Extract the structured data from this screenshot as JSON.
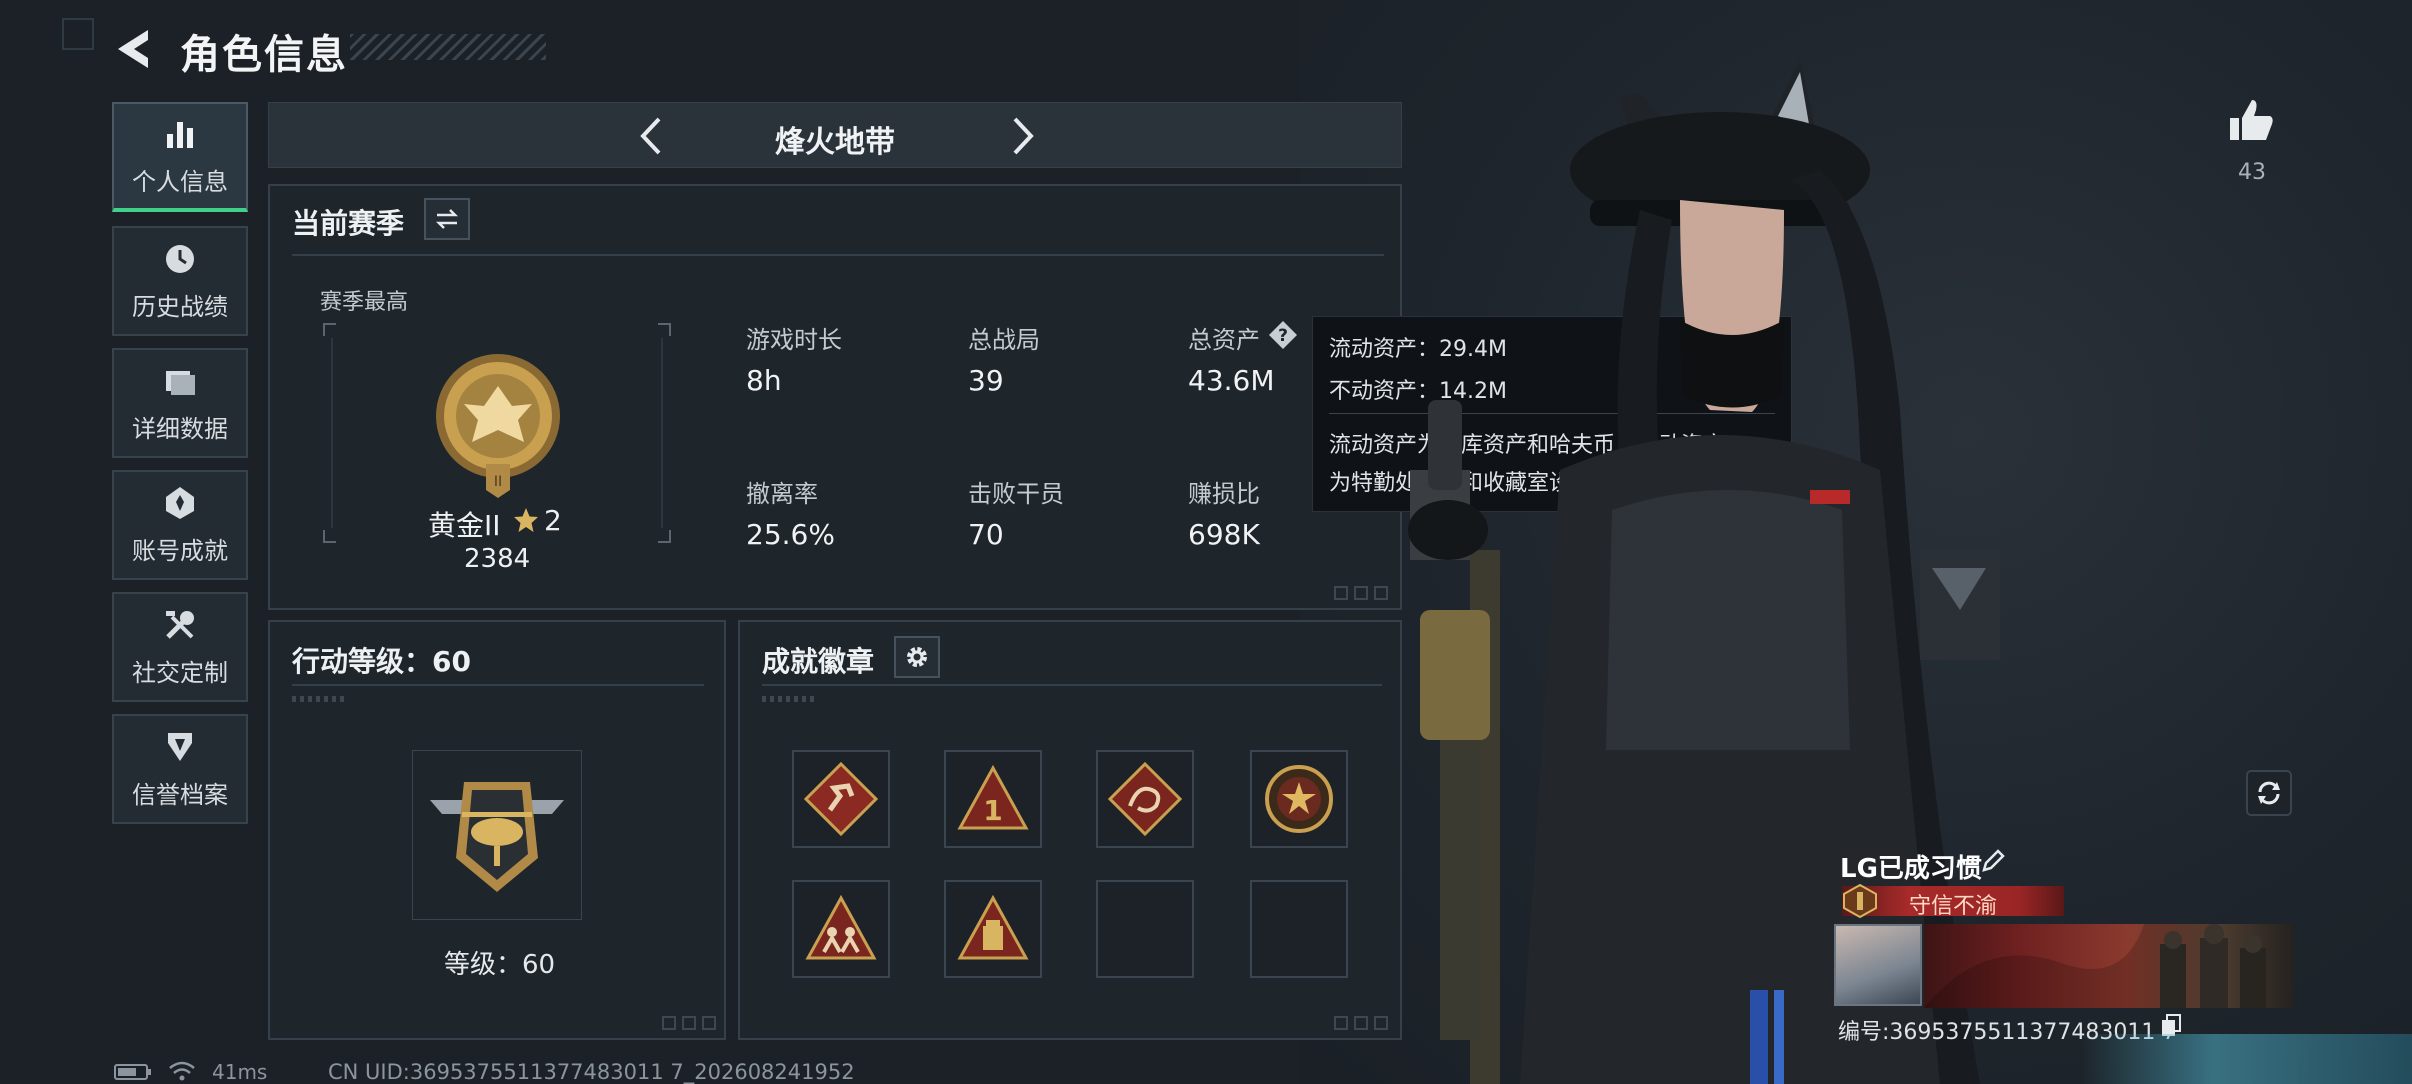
{
  "header": {
    "title": "角色信息"
  },
  "sidebar": {
    "items": [
      {
        "label": "个人信息",
        "icon": "bar-chart-icon",
        "active": true
      },
      {
        "label": "历史战绩",
        "icon": "clock-icon",
        "active": false
      },
      {
        "label": "详细数据",
        "icon": "folder-icon",
        "active": false
      },
      {
        "label": "账号成就",
        "icon": "medal-icon",
        "active": false
      },
      {
        "label": "社交定制",
        "icon": "tools-icon",
        "active": false
      },
      {
        "label": "信誉档案",
        "icon": "shield-icon",
        "active": false
      }
    ]
  },
  "mode": {
    "label": "烽火地带"
  },
  "season": {
    "title": "当前赛季",
    "best_label": "赛季最高",
    "rank_name": "黄金II",
    "rank_stars": "2",
    "rank_score": "2384",
    "stats": [
      {
        "label": "游戏时长",
        "value": "8h"
      },
      {
        "label": "总战局",
        "value": "39"
      },
      {
        "label": "总资产",
        "value": "43.6M"
      },
      {
        "label": "撤离率",
        "value": "25.6%"
      },
      {
        "label": "击败干员",
        "value": "70"
      },
      {
        "label": "赚损比",
        "value": "698K"
      }
    ]
  },
  "tooltip": {
    "line1": "流动资产：29.4M",
    "line2": "不动资产：14.2M",
    "desc1": "流动资产为仓库资产和哈夫币，不动资产",
    "desc2": "为特勤处设施和收藏室设施"
  },
  "action_level": {
    "title": "行动等级：60",
    "level_text": "等级：60"
  },
  "achievements": {
    "title": "成就徽章",
    "badge_count": 6,
    "slot_count": 8
  },
  "character": {
    "likes": "43",
    "player_name": "LG已成习惯",
    "player_title": "守信不渝",
    "uid_text": "编号:3695375511377483011 7"
  },
  "status": {
    "ping": "41ms",
    "uid": "CN UID:3695375511377483011 7_202608241952"
  },
  "colors": {
    "accent_green": "#3fd08a",
    "gold": "#c9a050",
    "title_red": "#a82a2a"
  }
}
